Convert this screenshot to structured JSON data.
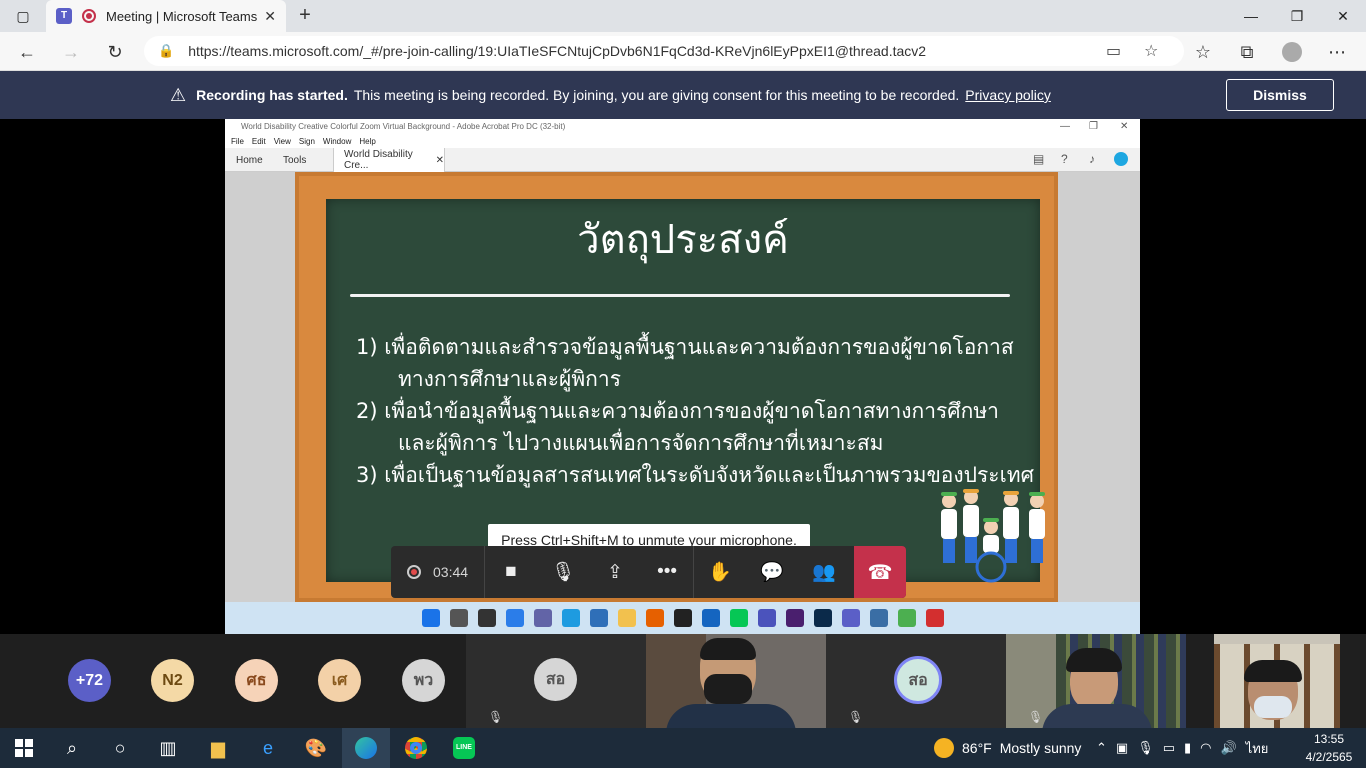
{
  "browser": {
    "tab_title": "Meeting | Microsoft Teams",
    "url": "https://teams.microsoft.com/_#/pre-join-calling/19:UIaTIeSFCNtujCpDvb6N1FqCd3d-KReVjn6lEyPpxEI1@thread.tacv2"
  },
  "banner": {
    "bold": "Recording has started.",
    "text": "This meeting is being recorded. By joining, you are giving consent for this meeting to be recorded.",
    "link": "Privacy policy",
    "dismiss": "Dismiss"
  },
  "acrobat": {
    "title": "World Disability Creative Colorful Zoom Virtual Background - Adobe Acrobat Pro DC (32-bit)",
    "menu": [
      "File",
      "Edit",
      "View",
      "Sign",
      "Window",
      "Help"
    ],
    "home_tab": "Home",
    "tools_tab": "Tools",
    "doc_tab": "World Disability Cre..."
  },
  "slide": {
    "title": "วัตถุประสงค์",
    "lines": [
      "1)  เพื่อติดตามและสำรวจข้อมูลพื้นฐานและความต้องการของผู้ขาดโอกาส",
      "ทางการศึกษาและผู้พิการ",
      "2)  เพื่อนำข้อมูลพื้นฐานและความต้องการของผู้ขาดโอกาสทางการศึกษา",
      "และผู้พิการ  ไปวางแผนเพื่อการจัดการศึกษาที่เหมาะสม",
      "3)  เพื่อเป็นฐานข้อมูลสารสนเทศในระดับจังหวัดและเป็นภาพรวมของประเทศ"
    ]
  },
  "meeting": {
    "tooltip": "Press Ctrl+Shift+M to unmute your microphone.",
    "timer": "03:44"
  },
  "participants": {
    "overflow": "+72",
    "avatars": [
      {
        "initials": "N2",
        "bg": "#f4d9a6",
        "fg": "#6d4a12"
      },
      {
        "initials": "ศธ",
        "bg": "#f6d3b8",
        "fg": "#8a4a1e"
      },
      {
        "initials": "เศ",
        "bg": "#f3d1a8",
        "fg": "#8a5b1e"
      },
      {
        "initials": "พว",
        "bg": "#d6d6d6",
        "fg": "#555555"
      }
    ],
    "tile1": "สอ",
    "tile2": "สอ"
  },
  "taskbar": {
    "temp": "86°F",
    "weather": "Mostly sunny",
    "lang": "ไทย",
    "time": "13:55",
    "date": "4/2/2565"
  },
  "colors": {
    "banner": "#2f3753",
    "hangup": "#c4314b",
    "board": "#2d4a3a",
    "overflow_avatar": "#5b5fc7"
  }
}
